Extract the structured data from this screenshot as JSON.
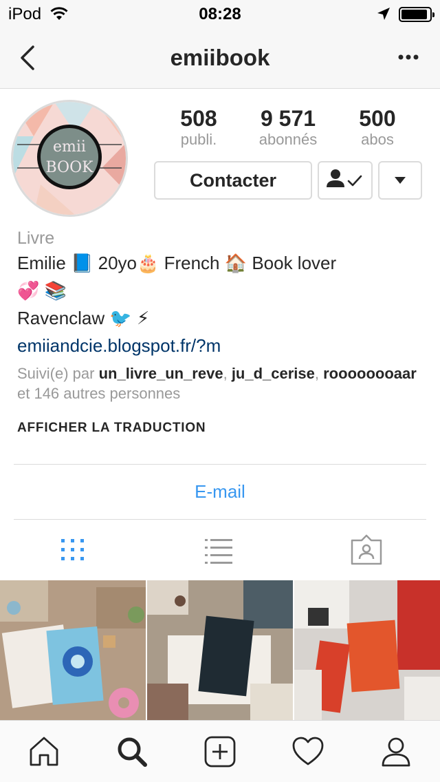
{
  "status_bar": {
    "carrier": "iPod",
    "time": "08:28"
  },
  "nav": {
    "title": "emiibook"
  },
  "profile": {
    "avatar_text": [
      "emii",
      "BOOK"
    ],
    "stats": [
      {
        "value": "508",
        "label": "publi."
      },
      {
        "value": "9 571",
        "label": "abonnés"
      },
      {
        "value": "500",
        "label": "abos"
      }
    ],
    "contact_label": "Contacter"
  },
  "bio": {
    "category": "Livre",
    "line1": "Emilie 📘 20yo🎂  French 🏠 Book lover",
    "line2": "💞 📚",
    "line3": "Ravenclaw 🐦 ⚡",
    "link": "emiiandcie.blogspot.fr/?m",
    "followed_prefix": "Suivi(e) par ",
    "followed_users": [
      "un_livre_un_reve",
      "ju_d_cerise",
      "roooooooaar"
    ],
    "followed_sep": ", ",
    "followed_suffix": " et 146 autres personnes"
  },
  "translate_label": "AFFICHER LA TRADUCTION",
  "email_label": "E-mail",
  "colors": {
    "link": "#003569",
    "accent": "#3897f0",
    "muted": "#999999",
    "border": "#dbdbdb"
  },
  "icons": {
    "back": "chevron-left-icon",
    "more": "more-horizontal-icon",
    "grid": "grid-icon",
    "list": "list-icon",
    "tagged": "tagged-icon",
    "home": "home-icon",
    "search": "search-icon",
    "add": "add-icon",
    "activity": "heart-icon",
    "profile": "profile-icon"
  }
}
